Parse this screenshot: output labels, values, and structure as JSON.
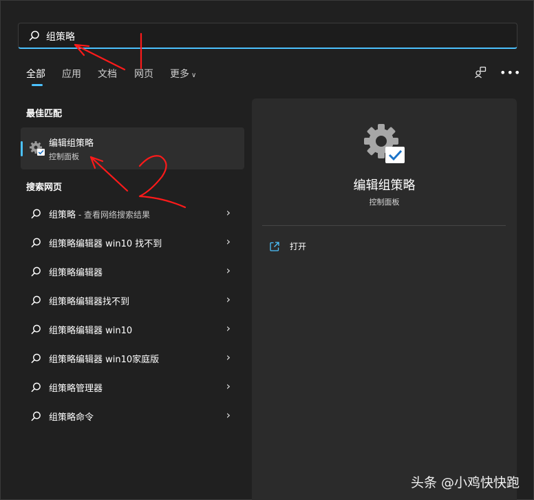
{
  "search": {
    "value": "组策略"
  },
  "tabs": [
    {
      "label": "全部",
      "active": true
    },
    {
      "label": "应用"
    },
    {
      "label": "文档"
    },
    {
      "label": "网页"
    },
    {
      "label": "更多"
    }
  ],
  "best_match": {
    "section_title": "最佳匹配",
    "name": "编辑组策略",
    "category": "控制面板"
  },
  "web_search": {
    "section_title": "搜索网页",
    "items": [
      {
        "label": "组策略",
        "suffix": " - 查看网络搜索结果"
      },
      {
        "label": "组策略编辑器 win10 找不到",
        "suffix": ""
      },
      {
        "label": "组策略编辑器",
        "suffix": ""
      },
      {
        "label": "组策略编辑器找不到",
        "suffix": ""
      },
      {
        "label": "组策略编辑器 win10",
        "suffix": ""
      },
      {
        "label": "组策略编辑器 win10家庭版",
        "suffix": ""
      },
      {
        "label": "组策略管理器",
        "suffix": ""
      },
      {
        "label": "组策略命令",
        "suffix": ""
      }
    ]
  },
  "detail": {
    "title": "编辑组策略",
    "subtitle": "控制面板",
    "actions": [
      {
        "label": "打开"
      }
    ]
  },
  "annotation": {
    "handwritten_digit": "2"
  },
  "watermark": {
    "text": "头条 @小鸡快快跑"
  },
  "colors": {
    "accent": "#4cc2ff",
    "background": "#202020",
    "panel": "#2b2b2b",
    "annotation": "#ff1a1a"
  }
}
